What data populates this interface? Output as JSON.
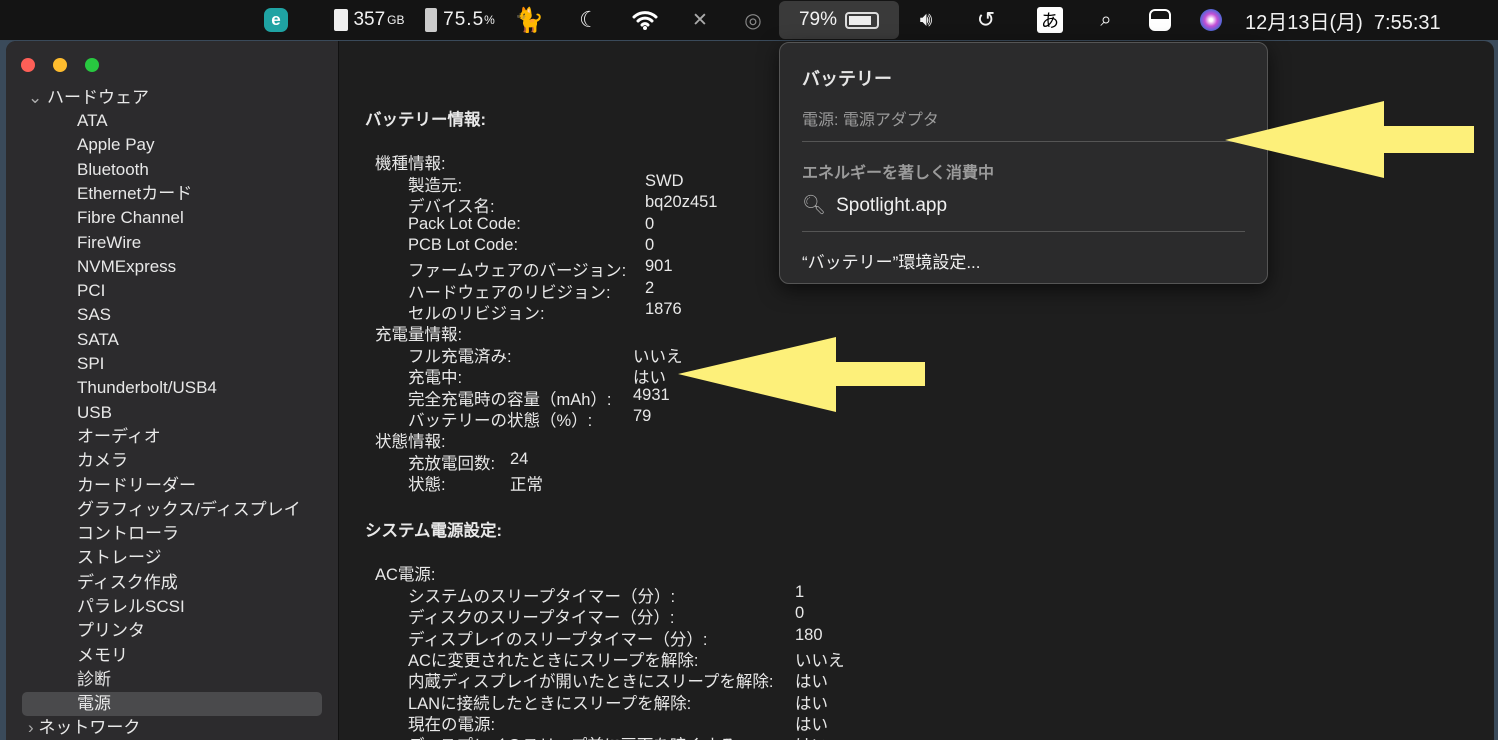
{
  "menubar": {
    "disk": "357",
    "disk_unit": "GB",
    "cpu_battery": "75.5",
    "cpu_unit": "%",
    "battery_percent": "79%",
    "ime": "あ",
    "clock": "12月13日(月)  7:55:31"
  },
  "sidebar": {
    "group": "ハードウェア",
    "items": [
      "ATA",
      "Apple Pay",
      "Bluetooth",
      "Ethernetカード",
      "Fibre Channel",
      "FireWire",
      "NVMExpress",
      "PCI",
      "SAS",
      "SATA",
      "SPI",
      "Thunderbolt/USB4",
      "USB",
      "オーディオ",
      "カメラ",
      "カードリーダー",
      "グラフィックス/ディスプレイ",
      "コントローラ",
      "ストレージ",
      "ディスク作成",
      "パラレルSCSI",
      "プリンタ",
      "メモリ",
      "診断",
      "電源"
    ],
    "next_group": "ネットワーク",
    "selected": "電源"
  },
  "main": {
    "battery_title": "バッテリー情報:",
    "model_header": "機種情報:",
    "model": [
      [
        "製造元:",
        "SWD"
      ],
      [
        "デバイス名:",
        "bq20z451"
      ],
      [
        "Pack Lot Code:",
        "0"
      ],
      [
        "PCB Lot Code:",
        "0"
      ],
      [
        "ファームウェアのバージョン:",
        "901"
      ],
      [
        "ハードウェアのリビジョン:",
        "2"
      ],
      [
        "セルのリビジョン:",
        "1876"
      ]
    ],
    "charge_header": "充電量情報:",
    "charge": [
      [
        "フル充電済み:",
        "いいえ"
      ],
      [
        "充電中:",
        "はい"
      ],
      [
        "完全充電時の容量（mAh）:",
        "4931"
      ],
      [
        "バッテリーの状態（%）:",
        "79"
      ]
    ],
    "state_header": "状態情報:",
    "state": [
      [
        "充放電回数:",
        "24"
      ],
      [
        "状態:",
        "正常"
      ]
    ],
    "power_title": "システム電源設定:",
    "ac_header": "AC電源:",
    "ac": [
      [
        "システムのスリープタイマー（分）:",
        "1"
      ],
      [
        "ディスクのスリープタイマー（分）:",
        "0"
      ],
      [
        "ディスプレイのスリープタイマー（分）:",
        "180"
      ],
      [
        "ACに変更されたときにスリープを解除:",
        "いいえ"
      ],
      [
        "内蔵ディスプレイが開いたときにスリープを解除:",
        "はい"
      ],
      [
        "LANに接続したときにスリープを解除:",
        "はい"
      ],
      [
        "現在の電源:",
        "はい"
      ],
      [
        "ディスプレイのスリープ前に画面を暗くする:",
        "はい"
      ]
    ]
  },
  "popup": {
    "title": "バッテリー",
    "source": "電源: 電源アダプタ",
    "energy_header": "エネルギーを著しく消費中",
    "app": "Spotlight.app",
    "prefs": "“バッテリー”環境設定..."
  },
  "colors": {
    "arrow": "#fdf07a"
  }
}
